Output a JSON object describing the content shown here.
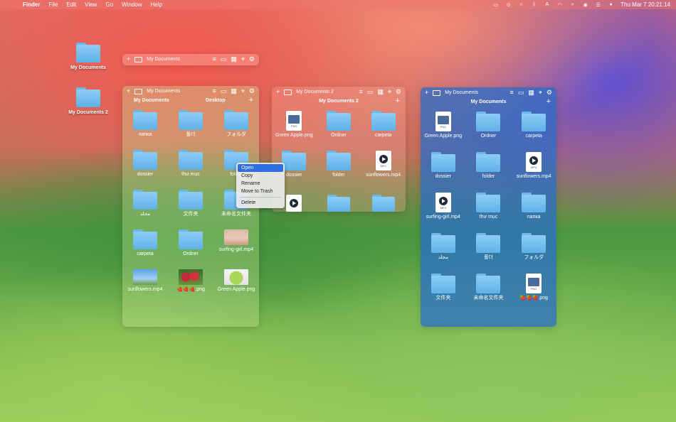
{
  "menubar": {
    "app": "Finder",
    "menus": [
      "File",
      "Edit",
      "View",
      "Go",
      "Window",
      "Help"
    ],
    "clock": "Thu Mar 7  20:21:14",
    "status_icons": [
      "display-icon",
      "play-icon",
      "headphones-icon",
      "bluetooth-icon",
      "input-a-icon",
      "wifi-icon",
      "search-icon",
      "user-icon",
      "control-center-icon",
      "siri-icon"
    ]
  },
  "desktop": {
    "items": [
      {
        "label": "My Documents"
      },
      {
        "label": "My Documents 2"
      }
    ]
  },
  "win_collapsed": {
    "title": "My Documents"
  },
  "win_left": {
    "title": "My Documents",
    "col1": "My Documents",
    "col2": "Desktop",
    "items": [
      {
        "label": "папка",
        "kind": "folder"
      },
      {
        "label": "폴더",
        "kind": "folder"
      },
      {
        "label": "フォルダ",
        "kind": "folder"
      },
      {
        "label": "dossier",
        "kind": "folder"
      },
      {
        "label": "thư mục",
        "kind": "folder"
      },
      {
        "label": "folder",
        "kind": "folder"
      },
      {
        "label": "مجلد",
        "kind": "folder"
      },
      {
        "label": "文件夹",
        "kind": "folder"
      },
      {
        "label": "未命名文件夹",
        "kind": "folder"
      },
      {
        "label": "carpeta",
        "kind": "folder"
      },
      {
        "label": "Ordner",
        "kind": "folder"
      },
      {
        "label": "surfing-girl.mp4",
        "kind": "thumb-beach"
      },
      {
        "label": "sunflowers.mp4",
        "kind": "thumb-sky"
      },
      {
        "label": "🍓🍓🍓.png",
        "kind": "thumb-berries"
      },
      {
        "label": "Green Apple.png",
        "kind": "thumb-apple"
      }
    ]
  },
  "context_menu": {
    "items": [
      "Open",
      "Copy",
      "Rename",
      "Move to Trash",
      "Delete"
    ]
  },
  "win_mid": {
    "title": "My Documents 2",
    "subtitle": "My Documents 2",
    "items": [
      {
        "label": "Green Apple.png",
        "kind": "png"
      },
      {
        "label": "Ordner",
        "kind": "folder"
      },
      {
        "label": "carpeta",
        "kind": "folder"
      },
      {
        "label": "dossier",
        "kind": "folder"
      },
      {
        "label": "folder",
        "kind": "folder"
      },
      {
        "label": "sunflowers.mp4",
        "kind": "mp4"
      }
    ]
  },
  "win_right": {
    "title": "My Documents",
    "subtitle": "My Documents",
    "items": [
      {
        "label": "Green Apple.png",
        "kind": "png"
      },
      {
        "label": "Ordner",
        "kind": "folder"
      },
      {
        "label": "carpeta",
        "kind": "folder"
      },
      {
        "label": "dossier",
        "kind": "folder"
      },
      {
        "label": "folder",
        "kind": "folder"
      },
      {
        "label": "sunflowers.mp4",
        "kind": "mp4"
      },
      {
        "label": "surfing-girl.mp4",
        "kind": "mp4"
      },
      {
        "label": "thư mục",
        "kind": "folder"
      },
      {
        "label": "папка",
        "kind": "folder"
      },
      {
        "label": "مجلد",
        "kind": "folder"
      },
      {
        "label": "폴더",
        "kind": "folder"
      },
      {
        "label": "フォルダ",
        "kind": "folder"
      },
      {
        "label": "文件夹",
        "kind": "folder"
      },
      {
        "label": "未命名文件夹",
        "kind": "folder"
      },
      {
        "label": "🍓🍓🍓.png",
        "kind": "png"
      }
    ]
  },
  "file_ext": {
    "png": "PNG",
    "mp4": "MP4"
  }
}
